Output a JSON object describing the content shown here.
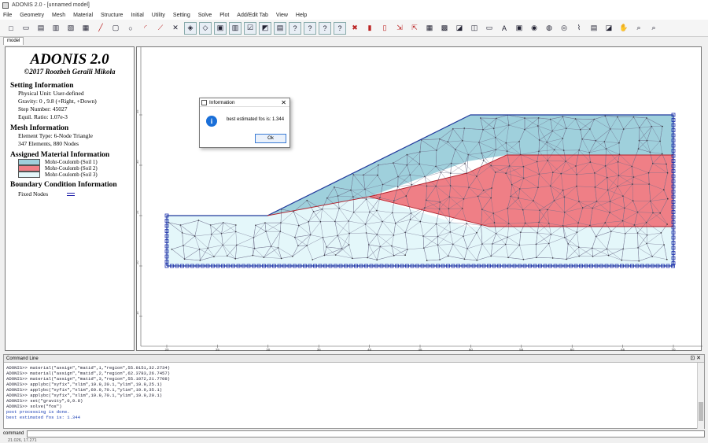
{
  "window": {
    "title": "ADONIS 2.0 - [unnamed model]"
  },
  "menu": [
    "File",
    "Geometry",
    "Mesh",
    "Material",
    "Structure",
    "Initial",
    "Utility",
    "Setting",
    "Solve",
    "Plot",
    "Add/Edit Tab",
    "View",
    "Help"
  ],
  "tab": "model",
  "info": {
    "app_name": "ADONIS 2.0",
    "copyright": "©2017 Roozbeh Geraili Mikola",
    "setting_title": "Setting Information",
    "physical_unit": "Physical Unit: User-defined",
    "gravity": "Gravity: 0 , 9.8 (+Right, +Down)",
    "step_number": "Step Number: 45027",
    "equil_ratio": "Equil. Ratio: 1.07e-3",
    "mesh_title": "Mesh Information",
    "element_type": "Element Type: 6-Node Triangle",
    "elements_nodes": "347 Elements, 880 Nodes",
    "material_title": "Assigned Material Information",
    "materials": [
      {
        "label": "Mohr-Coulomb (Soil 1)",
        "color": "#9fd0dc"
      },
      {
        "label": "Mohr-Coulomb (Soil 2)",
        "color": "#ef7f86"
      },
      {
        "label": "Mohr-Coulomb (Soil 3)",
        "color": "#e4f7fa"
      }
    ],
    "bc_title": "Boundary Condition Information",
    "bc_fixed": "Fixed Nodes"
  },
  "axis": {
    "x_ticks": [
      "20",
      "25",
      "30",
      "35",
      "40",
      "45",
      "50",
      "55",
      "60",
      "65",
      "70"
    ],
    "y_ticks": [
      "35",
      "30",
      "25",
      "20",
      "15"
    ]
  },
  "dialog": {
    "title": "Information",
    "message": "best estimated fos is: 1.344",
    "ok": "Ok"
  },
  "command": {
    "header": "Command Line",
    "log": [
      {
        "text": "ADONIS>> material(\"assign\",\"matid\",1,\"region\",55.9151,32.2734)",
        "blue": false
      },
      {
        "text": "ADONIS>> material(\"assign\",\"matid\",2,\"region\",62.3783,26.7457)",
        "blue": false
      },
      {
        "text": "ADONIS>> material(\"assign\",\"matid\",3,\"region\",55.1072,21.7708)",
        "blue": false
      },
      {
        "text": "ADONIS>> applybc(\"xyfix\",\"xlim\",19.9,20.1,\"ylim\",19.9,25.1)",
        "blue": false
      },
      {
        "text": "ADONIS>> applybc(\"xyfix\",\"xlim\",69.9,70.1,\"ylim\",19.9,35.1)",
        "blue": false
      },
      {
        "text": "ADONIS>> applybc(\"xyfix\",\"xlim\",19.9,70.1,\"ylim\",19.9,20.1)",
        "blue": false
      },
      {
        "text": "ADONIS>> set(\"gravity\",0,9.8)",
        "blue": false
      },
      {
        "text": "ADONIS>> solve(\"fos\")",
        "blue": false
      },
      {
        "text": "post processing is done.",
        "blue": true
      },
      {
        "text": "best estimated fos is: 1.344",
        "blue": true
      }
    ],
    "input_label": "command"
  },
  "status": "21.026, 17.271"
}
